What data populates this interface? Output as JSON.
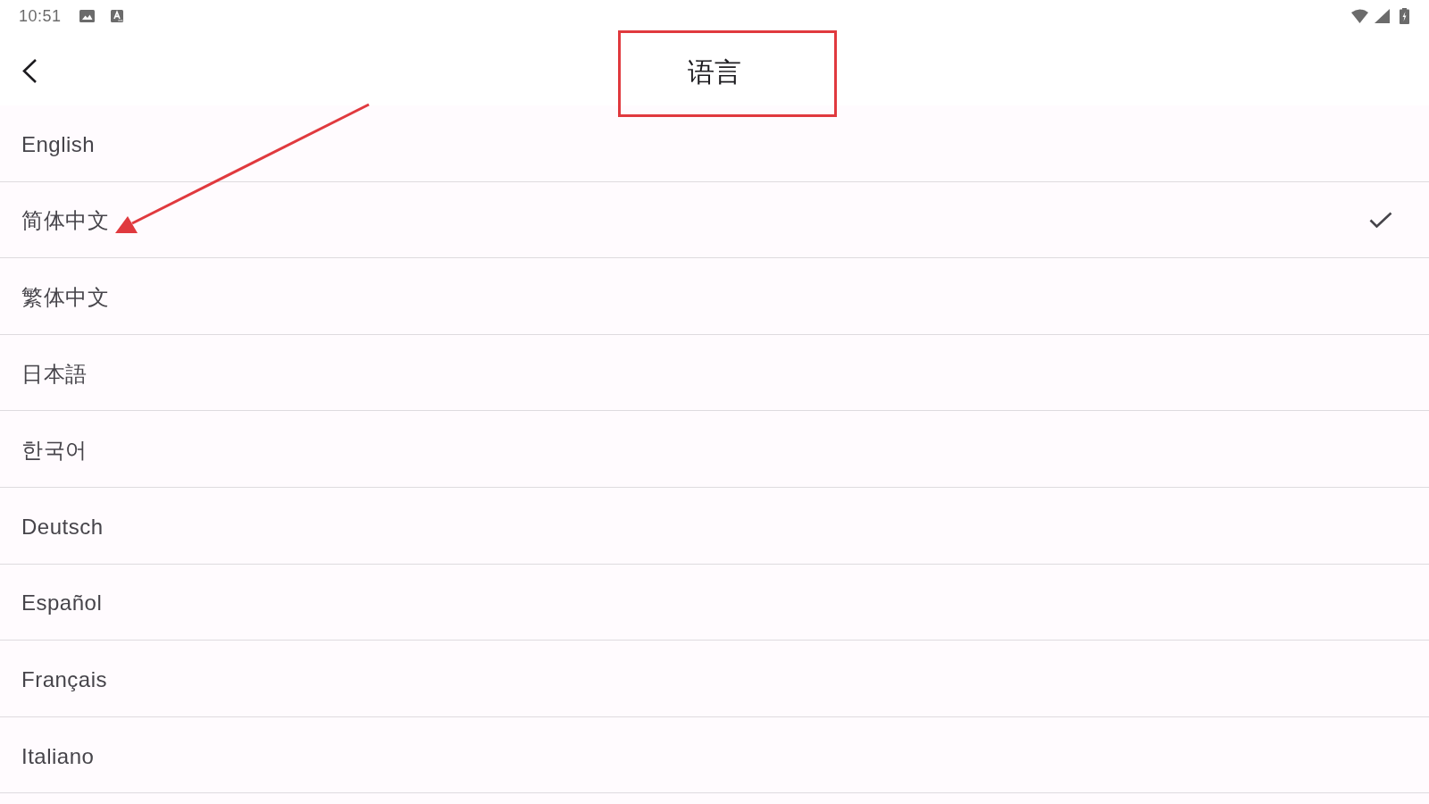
{
  "status_bar": {
    "time": "10:51"
  },
  "app_bar": {
    "title": "语言",
    "framed": true
  },
  "languages": [
    {
      "label": "English",
      "selected": false,
      "annotated": false
    },
    {
      "label": "简体中文",
      "selected": true,
      "annotated": true
    },
    {
      "label": "繁体中文",
      "selected": false,
      "annotated": false
    },
    {
      "label": "日本語",
      "selected": false,
      "annotated": false
    },
    {
      "label": "한국어",
      "selected": false,
      "annotated": false
    },
    {
      "label": "Deutsch",
      "selected": false,
      "annotated": false
    },
    {
      "label": "Español",
      "selected": false,
      "annotated": false
    },
    {
      "label": "Français",
      "selected": false,
      "annotated": false
    },
    {
      "label": "Italiano",
      "selected": false,
      "annotated": false
    }
  ]
}
